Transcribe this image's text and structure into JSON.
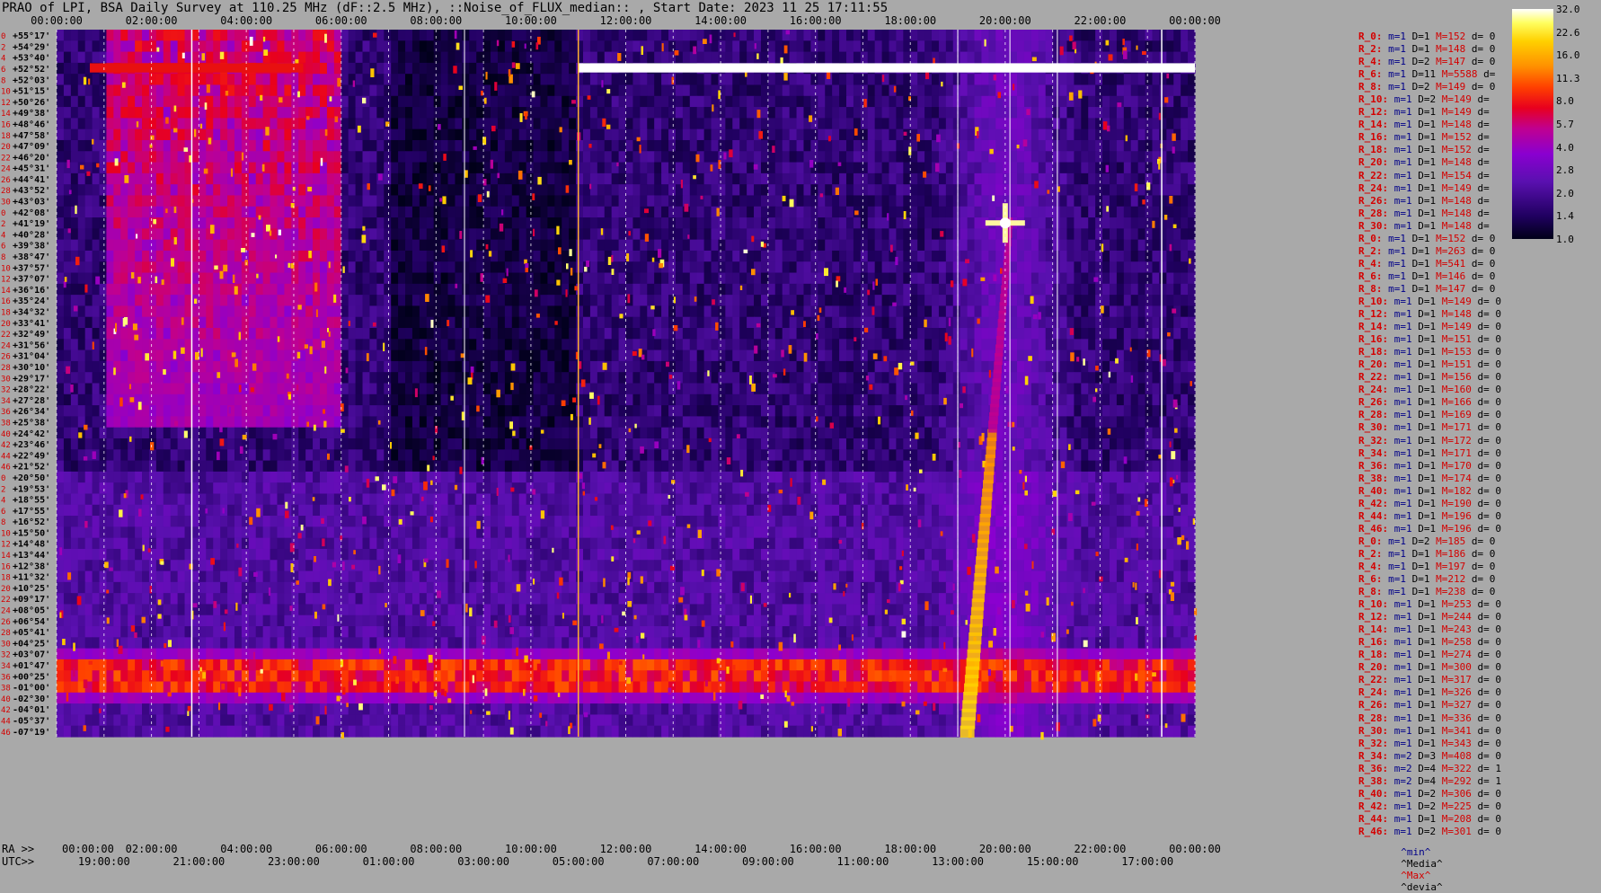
{
  "title": "PRAO of LPI, BSA Daily Survey at 110.25 MHz (dF::2.5 MHz), ::Noise_of_FLUX_median:: , Start Date: 2023 11 25 17:11:55",
  "chart_data": {
    "type": "heatmap",
    "title": "PRAO of LPI, BSA Daily Survey at 110.25 MHz (dF::2.5 MHz), ::Noise_of_FLUX_median:: , Start Date: 2023 11 25 17:11:55",
    "x_top_ticks": [
      "00:00:00",
      "02:00:00",
      "04:00:00",
      "06:00:00",
      "08:00:00",
      "10:00:00",
      "12:00:00",
      "14:00:00",
      "16:00:00",
      "18:00:00",
      "20:00:00",
      "22:00:00",
      "00:00:00"
    ],
    "x_ra_label": "RA >>",
    "x_ra_ticks": [
      "00:00:00",
      "02:00:00",
      "04:00:00",
      "06:00:00",
      "08:00:00",
      "10:00:00",
      "12:00:00",
      "14:00:00",
      "16:00:00",
      "18:00:00",
      "20:00:00",
      "22:00:00",
      "00:00:00"
    ],
    "x_utc_label": "UTC>>",
    "x_utc_ticks": [
      "19:00:00",
      "21:00:00",
      "23:00:00",
      "01:00:00",
      "03:00:00",
      "05:00:00",
      "07:00:00",
      "09:00:00",
      "11:00:00",
      "13:00:00",
      "15:00:00",
      "17:00:00"
    ],
    "y_declinations": [
      "+55°17'",
      "+54°29'",
      "+53°40'",
      "+52°52'",
      "+52°03'",
      "+51°15'",
      "+50°26'",
      "+49°38'",
      "+48°46'",
      "+47°58'",
      "+47°09'",
      "+46°20'",
      "+45°31'",
      "+44°41'",
      "+43°52'",
      "+43°03'",
      "+42°08'",
      "+41°19'",
      "+40°28'",
      "+39°38'",
      "+38°47'",
      "+37°57'",
      "+37°07'",
      "+36°16'",
      "+35°24'",
      "+34°32'",
      "+33°41'",
      "+32°49'",
      "+31°56'",
      "+31°04'",
      "+30°10'",
      "+29°17'",
      "+28°22'",
      "+27°28'",
      "+26°34'",
      "+25°38'",
      "+24°42'",
      "+23°46'",
      "+22°49'",
      "+21°52'",
      "+20°50'",
      "+19°53'",
      "+18°55'",
      "+17°55'",
      "+16°52'",
      "+15°50'",
      "+14°48'",
      "+13°44'",
      "+12°38'",
      "+11°32'",
      "+10°25'",
      "+09°17'",
      "+08°05'",
      "+06°54'",
      "+05°41'",
      "+04°25'",
      "+03°07'",
      "+01°47'",
      "+00°25'",
      "-01°00'",
      "-02°30'",
      "-04°01'",
      "-05°37'",
      "-07°19'"
    ],
    "colorbar_ticks": [
      32.0,
      22.6,
      16.0,
      11.3,
      8.0,
      5.7,
      4.0,
      2.8,
      2.0,
      1.4,
      1.0
    ],
    "colorbar_scale": "log",
    "colormap": [
      "#000018",
      "#200060",
      "#5a10b0",
      "#8a00d0",
      "#c00090",
      "#e8001e",
      "#ff4000",
      "#ff9000",
      "#ffd000",
      "#ffff60",
      "#ffffff"
    ],
    "vertical_marker_lines_ra_hours": [
      2.85,
      11.0,
      23.3
    ],
    "features": [
      {
        "kind": "sun_trail",
        "ra_start": 19.2,
        "dec_start": "-07°19'",
        "ra_end": 20.1,
        "dec_end": "+41°19'"
      },
      {
        "kind": "bright_source",
        "ra": 20.0,
        "dec": "+41°19'",
        "value": 32.0
      },
      {
        "kind": "saturated_row",
        "dec": "+52°52'",
        "ra_start": 0.0,
        "ra_end": 24.0
      },
      {
        "kind": "equatorial_band",
        "dec_from": "+01°47'",
        "dec_to": "-01°00'"
      }
    ]
  },
  "stats_rows": [
    {
      "r": "R_0:",
      "m": "m=1",
      "d": "D=1",
      "M": "M=152",
      "dv": "d= 0"
    },
    {
      "r": "R_2:",
      "m": "m=1",
      "d": "D=1",
      "M": "M=148",
      "dv": "d= 0"
    },
    {
      "r": "R_4:",
      "m": "m=1",
      "d": "D=2",
      "M": "M=147",
      "dv": "d= 0"
    },
    {
      "r": "R_6:",
      "m": "m=1",
      "d": "D=11",
      "M": "M=5588",
      "dv": "d="
    },
    {
      "r": "R_8:",
      "m": "m=1",
      "d": "D=2",
      "M": "M=149",
      "dv": "d= 0"
    },
    {
      "r": "R_10:",
      "m": "m=1",
      "d": "D=2",
      "M": "M=149",
      "dv": "d="
    },
    {
      "r": "R_12:",
      "m": "m=1",
      "d": "D=1",
      "M": "M=149",
      "dv": "d="
    },
    {
      "r": "R_14:",
      "m": "m=1",
      "d": "D=1",
      "M": "M=148",
      "dv": "d="
    },
    {
      "r": "R_16:",
      "m": "m=1",
      "d": "D=1",
      "M": "M=152",
      "dv": "d="
    },
    {
      "r": "R_18:",
      "m": "m=1",
      "d": "D=1",
      "M": "M=152",
      "dv": "d="
    },
    {
      "r": "R_20:",
      "m": "m=1",
      "d": "D=1",
      "M": "M=148",
      "dv": "d="
    },
    {
      "r": "R_22:",
      "m": "m=1",
      "d": "D=1",
      "M": "M=154",
      "dv": "d="
    },
    {
      "r": "R_24:",
      "m": "m=1",
      "d": "D=1",
      "M": "M=149",
      "dv": "d="
    },
    {
      "r": "R_26:",
      "m": "m=1",
      "d": "D=1",
      "M": "M=148",
      "dv": "d="
    },
    {
      "r": "R_28:",
      "m": "m=1",
      "d": "D=1",
      "M": "M=148",
      "dv": "d="
    },
    {
      "r": "R_30:",
      "m": "m=1",
      "d": "D=1",
      "M": "M=148",
      "dv": "d="
    },
    {
      "r": "R_0:",
      "m": "m=1",
      "d": "D=1",
      "M": "M=152",
      "dv": "d= 0"
    },
    {
      "r": "R_2:",
      "m": "m=1",
      "d": "D=1",
      "M": "M=263",
      "dv": "d= 0"
    },
    {
      "r": "R_4:",
      "m": "m=1",
      "d": "D=1",
      "M": "M=541",
      "dv": "d= 0"
    },
    {
      "r": "R_6:",
      "m": "m=1",
      "d": "D=1",
      "M": "M=146",
      "dv": "d= 0"
    },
    {
      "r": "R_8:",
      "m": "m=1",
      "d": "D=1",
      "M": "M=147",
      "dv": "d= 0"
    },
    {
      "r": "R_10:",
      "m": "m=1",
      "d": "D=1",
      "M": "M=149",
      "dv": "d= 0"
    },
    {
      "r": "R_12:",
      "m": "m=1",
      "d": "D=1",
      "M": "M=148",
      "dv": "d= 0"
    },
    {
      "r": "R_14:",
      "m": "m=1",
      "d": "D=1",
      "M": "M=149",
      "dv": "d= 0"
    },
    {
      "r": "R_16:",
      "m": "m=1",
      "d": "D=1",
      "M": "M=151",
      "dv": "d= 0"
    },
    {
      "r": "R_18:",
      "m": "m=1",
      "d": "D=1",
      "M": "M=153",
      "dv": "d= 0"
    },
    {
      "r": "R_20:",
      "m": "m=1",
      "d": "D=1",
      "M": "M=151",
      "dv": "d= 0"
    },
    {
      "r": "R_22:",
      "m": "m=1",
      "d": "D=1",
      "M": "M=156",
      "dv": "d= 0"
    },
    {
      "r": "R_24:",
      "m": "m=1",
      "d": "D=1",
      "M": "M=160",
      "dv": "d= 0"
    },
    {
      "r": "R_26:",
      "m": "m=1",
      "d": "D=1",
      "M": "M=166",
      "dv": "d= 0"
    },
    {
      "r": "R_28:",
      "m": "m=1",
      "d": "D=1",
      "M": "M=169",
      "dv": "d= 0"
    },
    {
      "r": "R_30:",
      "m": "m=1",
      "d": "D=1",
      "M": "M=171",
      "dv": "d= 0"
    },
    {
      "r": "R_32:",
      "m": "m=1",
      "d": "D=1",
      "M": "M=172",
      "dv": "d= 0"
    },
    {
      "r": "R_34:",
      "m": "m=1",
      "d": "D=1",
      "M": "M=171",
      "dv": "d= 0"
    },
    {
      "r": "R_36:",
      "m": "m=1",
      "d": "D=1",
      "M": "M=170",
      "dv": "d= 0"
    },
    {
      "r": "R_38:",
      "m": "m=1",
      "d": "D=1",
      "M": "M=174",
      "dv": "d= 0"
    },
    {
      "r": "R_40:",
      "m": "m=1",
      "d": "D=1",
      "M": "M=182",
      "dv": "d= 0"
    },
    {
      "r": "R_42:",
      "m": "m=1",
      "d": "D=1",
      "M": "M=190",
      "dv": "d= 0"
    },
    {
      "r": "R_44:",
      "m": "m=1",
      "d": "D=1",
      "M": "M=196",
      "dv": "d= 0"
    },
    {
      "r": "R_46:",
      "m": "m=1",
      "d": "D=1",
      "M": "M=196",
      "dv": "d= 0"
    },
    {
      "r": "R_0:",
      "m": "m=1",
      "d": "D=2",
      "M": "M=185",
      "dv": "d= 0"
    },
    {
      "r": "R_2:",
      "m": "m=1",
      "d": "D=1",
      "M": "M=186",
      "dv": "d= 0"
    },
    {
      "r": "R_4:",
      "m": "m=1",
      "d": "D=1",
      "M": "M=197",
      "dv": "d= 0"
    },
    {
      "r": "R_6:",
      "m": "m=1",
      "d": "D=1",
      "M": "M=212",
      "dv": "d= 0"
    },
    {
      "r": "R_8:",
      "m": "m=1",
      "d": "D=1",
      "M": "M=238",
      "dv": "d= 0"
    },
    {
      "r": "R_10:",
      "m": "m=1",
      "d": "D=1",
      "M": "M=253",
      "dv": "d= 0"
    },
    {
      "r": "R_12:",
      "m": "m=1",
      "d": "D=1",
      "M": "M=244",
      "dv": "d= 0"
    },
    {
      "r": "R_14:",
      "m": "m=1",
      "d": "D=1",
      "M": "M=243",
      "dv": "d= 0"
    },
    {
      "r": "R_16:",
      "m": "m=1",
      "d": "D=1",
      "M": "M=258",
      "dv": "d= 0"
    },
    {
      "r": "R_18:",
      "m": "m=1",
      "d": "D=1",
      "M": "M=274",
      "dv": "d= 0"
    },
    {
      "r": "R_20:",
      "m": "m=1",
      "d": "D=1",
      "M": "M=300",
      "dv": "d= 0"
    },
    {
      "r": "R_22:",
      "m": "m=1",
      "d": "D=1",
      "M": "M=317",
      "dv": "d= 0"
    },
    {
      "r": "R_24:",
      "m": "m=1",
      "d": "D=1",
      "M": "M=326",
      "dv": "d= 0"
    },
    {
      "r": "R_26:",
      "m": "m=1",
      "d": "D=1",
      "M": "M=327",
      "dv": "d= 0"
    },
    {
      "r": "R_28:",
      "m": "m=1",
      "d": "D=1",
      "M": "M=336",
      "dv": "d= 0"
    },
    {
      "r": "R_30:",
      "m": "m=1",
      "d": "D=1",
      "M": "M=341",
      "dv": "d= 0"
    },
    {
      "r": "R_32:",
      "m": "m=1",
      "d": "D=1",
      "M": "M=343",
      "dv": "d= 0"
    },
    {
      "r": "R_34:",
      "m": "m=2",
      "d": "D=3",
      "M": "M=408",
      "dv": "d= 0"
    },
    {
      "r": "R_36:",
      "m": "m=2",
      "d": "D=4",
      "M": "M=322",
      "dv": "d= 1"
    },
    {
      "r": "R_38:",
      "m": "m=2",
      "d": "D=4",
      "M": "M=292",
      "dv": "d= 1"
    },
    {
      "r": "R_40:",
      "m": "m=1",
      "d": "D=2",
      "M": "M=306",
      "dv": "d= 0"
    },
    {
      "r": "R_42:",
      "m": "m=1",
      "d": "D=2",
      "M": "M=225",
      "dv": "d= 0"
    },
    {
      "r": "R_44:",
      "m": "m=1",
      "d": "D=1",
      "M": "M=208",
      "dv": "d= 0"
    },
    {
      "r": "R_46:",
      "m": "m=1",
      "d": "D=2",
      "M": "M=301",
      "dv": "d= 0"
    }
  ],
  "row_index_labels": [
    "0",
    "2",
    "4",
    "6",
    "8",
    "10",
    "12",
    "14",
    "16",
    "18",
    "20",
    "22",
    "24",
    "26",
    "28",
    "30",
    "0",
    "2",
    "4",
    "6",
    "8",
    "10",
    "12",
    "14",
    "16",
    "18",
    "20",
    "22",
    "24",
    "26",
    "28",
    "30",
    "32",
    "34",
    "36",
    "38",
    "40",
    "42",
    "44",
    "46",
    "0",
    "2",
    "4",
    "6",
    "8",
    "10",
    "12",
    "14",
    "16",
    "18",
    "20",
    "22",
    "24",
    "26",
    "28",
    "30",
    "32",
    "34",
    "36",
    "38",
    "40",
    "42",
    "44",
    "46"
  ],
  "notes": {
    "min": "^min^",
    "median": "^Media^",
    "max": "^Max^",
    "devia": "^devia^"
  },
  "colors": {
    "min": "#000088",
    "median": "#000000",
    "max": "#d40000",
    "devia": "#000000",
    "background": "#a9a9a9"
  }
}
